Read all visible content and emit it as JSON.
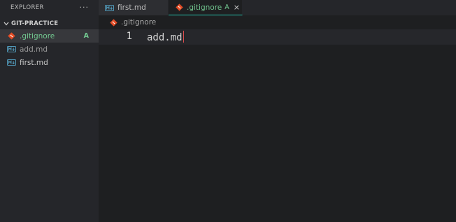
{
  "sidebar": {
    "title": "EXPLORER",
    "more": "···",
    "section": "GIT-PRACTICE",
    "files": [
      {
        "name": ".gitignore",
        "badge": "A"
      },
      {
        "name": "add.md"
      },
      {
        "name": "first.md"
      }
    ]
  },
  "tabs": [
    {
      "name": "first.md"
    },
    {
      "name": ".gitignore",
      "badge": "A",
      "close": "×"
    }
  ],
  "breadcrumb": {
    "file": ".gitignore"
  },
  "editor": {
    "lines": [
      {
        "number": "1",
        "text": "add.md"
      }
    ]
  },
  "colors": {
    "git_added": "#73c991",
    "git_icon": "#e44d26",
    "markdown_icon": "#519aba",
    "active_tab_border": "#26c6b0"
  }
}
